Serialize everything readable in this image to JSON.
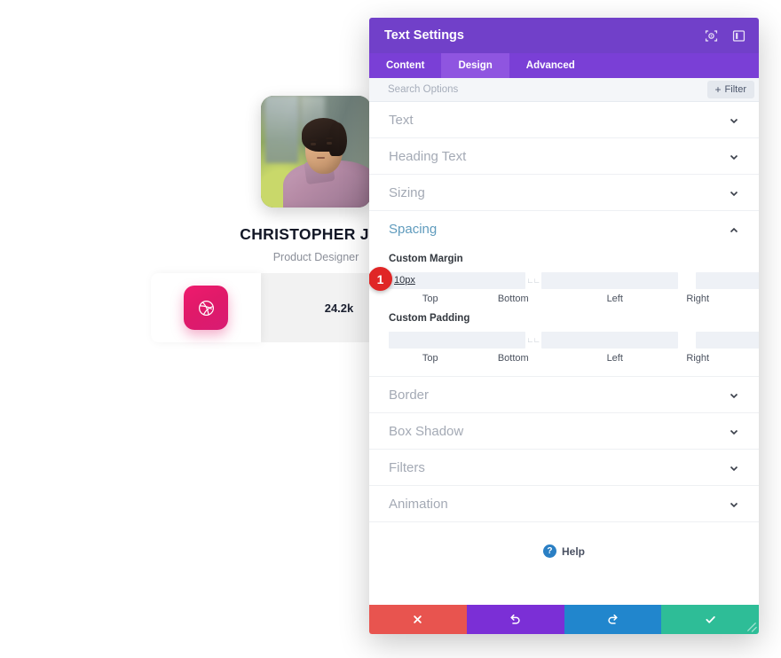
{
  "canvas": {
    "profile": {
      "name": "CHRISTOPHER JOE",
      "role": "Product Designer",
      "avatar_alt": "portrait-photo"
    },
    "stat_card": {
      "icon": "dribbble-icon",
      "value": "24.2k"
    }
  },
  "panel": {
    "title": "Text Settings",
    "header_icons": [
      {
        "name": "focus-target-icon"
      },
      {
        "name": "panel-layout-icon"
      }
    ],
    "tabs": [
      {
        "label": "Content",
        "active": false
      },
      {
        "label": "Design",
        "active": true
      },
      {
        "label": "Advanced",
        "active": false
      }
    ],
    "search": {
      "placeholder": "Search Options",
      "value": ""
    },
    "filter_button": {
      "label": "Filter",
      "plus": "+"
    },
    "sections": [
      {
        "label": "Text",
        "open": false
      },
      {
        "label": "Heading Text",
        "open": false
      },
      {
        "label": "Sizing",
        "open": false
      },
      {
        "label": "Spacing",
        "open": true
      },
      {
        "label": "Border",
        "open": false
      },
      {
        "label": "Box Shadow",
        "open": false
      },
      {
        "label": "Filters",
        "open": false
      },
      {
        "label": "Animation",
        "open": false
      }
    ],
    "spacing": {
      "margin": {
        "group_label": "Custom Margin",
        "fields": [
          {
            "label": "Top",
            "value": "10px",
            "placeholder": ""
          },
          {
            "label": "Bottom",
            "value": "",
            "placeholder": ""
          },
          {
            "label": "Left",
            "value": "",
            "placeholder": ""
          },
          {
            "label": "Right",
            "value": "",
            "placeholder": ""
          }
        ]
      },
      "padding": {
        "group_label": "Custom Padding",
        "fields": [
          {
            "label": "Top",
            "value": "",
            "placeholder": ""
          },
          {
            "label": "Bottom",
            "value": "",
            "placeholder": ""
          },
          {
            "label": "Left",
            "value": "",
            "placeholder": ""
          },
          {
            "label": "Right",
            "value": "",
            "placeholder": ""
          }
        ]
      }
    },
    "step_badge": "1",
    "help": {
      "label": "Help",
      "icon_char": "?"
    },
    "footer_buttons": [
      {
        "name": "close-button",
        "icon": "x-icon",
        "color": "#e8544f"
      },
      {
        "name": "undo-button",
        "icon": "undo-icon",
        "color": "#7b2fd6"
      },
      {
        "name": "redo-button",
        "icon": "redo-icon",
        "color": "#2186cd"
      },
      {
        "name": "save-button",
        "icon": "check-icon",
        "color": "#2ebd97"
      }
    ]
  },
  "colors": {
    "header_purple": "#7140c9",
    "tabs_purple": "#7a3fd6",
    "tab_active_purple": "#8f55e0",
    "accent_blue": "#5f9bbd",
    "badge_red": "#e02626",
    "dribbble_pink": "#e01a69"
  }
}
